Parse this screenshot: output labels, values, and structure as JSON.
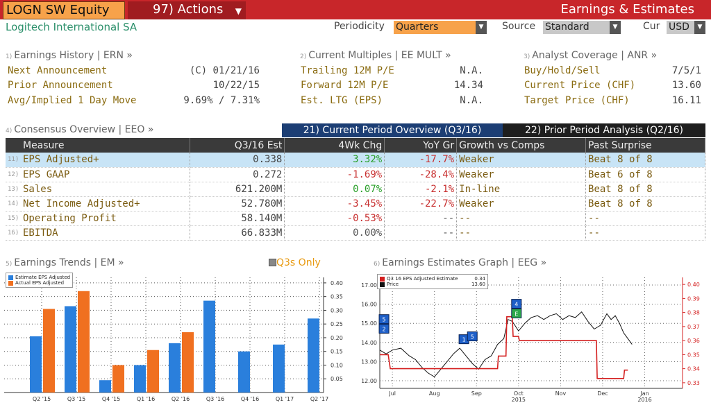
{
  "header": {
    "ticker": "LOGN SW Equity",
    "actions_label": "97) Actions",
    "title": "Earnings & Estimates",
    "company": "Logitech International SA"
  },
  "controls": {
    "periodicity_label": "Periodicity",
    "periodicity_value": "Quarters",
    "source_label": "Source",
    "source_value": "Standard",
    "cur_label": "Cur",
    "cur_value": "USD"
  },
  "earnings_history": {
    "num": "1)",
    "title": "Earnings History | ERN »",
    "rows": [
      {
        "label": "Next Announcement",
        "value": "(C)  01/21/16"
      },
      {
        "label": "Prior Announcement",
        "value": "10/22/15"
      },
      {
        "label": "Avg/Implied 1 Day Move",
        "value": "9.69% / 7.31%"
      }
    ]
  },
  "current_multiples": {
    "num": "2)",
    "title": "Current Multiples | EE MULT »",
    "rows": [
      {
        "label": "Trailing 12M P/E",
        "value": "N.A."
      },
      {
        "label": "Forward 12M P/E",
        "value": "14.34"
      },
      {
        "label": "Est. LTG (EPS)",
        "value": "N.A."
      }
    ]
  },
  "analyst_coverage": {
    "num": "3)",
    "title": "Analyst Coverage | ANR »",
    "rows": [
      {
        "label": "Buy/Hold/Sell",
        "value": "7/5/1"
      },
      {
        "label": "Current Price (CHF)",
        "value": "13.60"
      },
      {
        "label": "Target Price (CHF)",
        "value": "16.11"
      }
    ]
  },
  "consensus": {
    "num": "4)",
    "title": "Consensus Overview | EEO »",
    "tab_current": "21) Current Period Overview (Q3/16)",
    "tab_prior": "22) Prior Period Analysis (Q2/16)",
    "columns": [
      "Measure",
      "Q3/16 Est",
      "4Wk Chg",
      "YoY Gr",
      "Growth vs Comps",
      "Past Surprise"
    ],
    "rows": [
      {
        "n": "11)",
        "measure": "EPS Adjusted+",
        "est": "0.338",
        "chg": "3.32%",
        "chg_sign": "pos",
        "yoy": "-17.7%",
        "yoy_sign": "neg",
        "growth": "Weaker",
        "surprise": "Beat 8 of 8"
      },
      {
        "n": "12)",
        "measure": "EPS GAAP",
        "est": "0.272",
        "chg": "-1.69%",
        "chg_sign": "neg",
        "yoy": "-28.4%",
        "yoy_sign": "neg",
        "growth": "Weaker",
        "surprise": "Beat 6 of 8"
      },
      {
        "n": "13)",
        "measure": "Sales",
        "est": "621.200M",
        "chg": "0.07%",
        "chg_sign": "pos",
        "yoy": "-2.1%",
        "yoy_sign": "neg",
        "growth": "In-line",
        "surprise": "Beat 8 of 8"
      },
      {
        "n": "14)",
        "measure": "Net Income Adjusted+",
        "est": "52.780M",
        "chg": "-3.45%",
        "chg_sign": "neg",
        "yoy": "-22.7%",
        "yoy_sign": "neg",
        "growth": "Weaker",
        "surprise": "Beat 8 of 8"
      },
      {
        "n": "15)",
        "measure": "Operating Profit",
        "est": "58.140M",
        "chg": "-0.53%",
        "chg_sign": "neg",
        "yoy": "--",
        "yoy_sign": "nz",
        "growth": "--",
        "surprise": "--"
      },
      {
        "n": "16)",
        "measure": "EBITDA",
        "est": "66.833M",
        "chg": "0.00%",
        "chg_sign": "nz",
        "yoy": "--",
        "yoy_sign": "nz",
        "growth": "--",
        "surprise": "--"
      }
    ]
  },
  "earnings_trends": {
    "num": "5)",
    "title": "Earnings Trends | EM »",
    "toggle_label": "Q3s Only",
    "colors": {
      "estimate": "#2a7fdc",
      "actual": "#f07020"
    }
  },
  "earnings_graph": {
    "num": "6)",
    "title": "Earnings Estimates Graph | EEG »",
    "legend_estimate_label": "Q3 16 EPS Adjusted Estimate",
    "legend_estimate_value": "0.34",
    "legend_price_label": "Price",
    "legend_price_value": "13.60",
    "colors": {
      "estimate": "#d42020",
      "price": "#111111"
    }
  },
  "chart_data": [
    {
      "type": "bar",
      "categories": [
        "Q2 '15",
        "Q3 '15",
        "Q4 '15",
        "Q1 '16",
        "Q2 '16",
        "Q3 '16",
        "Q4 '16",
        "Q1 '17",
        "Q2 '17"
      ],
      "series": [
        {
          "name": "Estimate EPS Adjusted",
          "values": [
            0.205,
            0.315,
            0.045,
            0.1,
            0.18,
            0.335,
            0.15,
            0.175,
            0.27
          ]
        },
        {
          "name": "Actual EPS Adjusted",
          "values": [
            0.305,
            0.37,
            0.1,
            0.155,
            0.22,
            null,
            null,
            null,
            null
          ]
        }
      ],
      "y_ticks": [
        "0.05",
        "0.10",
        "0.15",
        "0.20",
        "0.25",
        "0.30",
        "0.35",
        "0.40"
      ],
      "ylim": [
        0,
        0.42
      ],
      "y_axis": "right",
      "legend": "top-left",
      "grid": true
    },
    {
      "type": "line",
      "x_ticks": [
        "Jul",
        "Aug",
        "Sep",
        "Oct",
        "Nov",
        "Dec",
        "Jan"
      ],
      "x_subticks": [
        "2015",
        "2016"
      ],
      "left_ticks": [
        "12.00",
        "13.00",
        "14.00",
        "15.00",
        "16.00",
        "17.00"
      ],
      "right_ticks": [
        "0.33",
        "0.34",
        "0.35",
        "0.36",
        "0.37",
        "0.38",
        "0.39",
        "0.40"
      ],
      "left_ylim": [
        11.6,
        17.4
      ],
      "right_ylim": [
        0.326,
        0.405
      ],
      "xlim": [
        0,
        7.2
      ],
      "series": [
        {
          "name": "Q3 16 EPS Adjusted Estimate",
          "axis": "right",
          "points": [
            [
              0,
              0.35
            ],
            [
              0.2,
              0.35
            ],
            [
              0.25,
              0.34
            ],
            [
              1,
              0.34
            ],
            [
              2,
              0.34
            ],
            [
              2.8,
              0.34
            ],
            [
              2.82,
              0.349
            ],
            [
              3.0,
              0.349
            ],
            [
              3.02,
              0.377
            ],
            [
              3.15,
              0.377
            ],
            [
              3.17,
              0.363
            ],
            [
              3.3,
              0.363
            ],
            [
              3.32,
              0.36
            ],
            [
              4,
              0.36
            ],
            [
              5,
              0.36
            ],
            [
              5.15,
              0.36
            ],
            [
              5.17,
              0.333
            ],
            [
              5.8,
              0.333
            ],
            [
              5.82,
              0.339
            ],
            [
              5.9,
              0.339
            ]
          ]
        },
        {
          "name": "Price",
          "axis": "left",
          "points": [
            [
              0,
              13.6
            ],
            [
              0.15,
              13.4
            ],
            [
              0.3,
              13.6
            ],
            [
              0.5,
              13.7
            ],
            [
              0.7,
              13.3
            ],
            [
              0.85,
              13.1
            ],
            [
              1.0,
              12.7
            ],
            [
              1.15,
              12.4
            ],
            [
              1.3,
              12.2
            ],
            [
              1.45,
              12.6
            ],
            [
              1.6,
              13.0
            ],
            [
              1.75,
              13.4
            ],
            [
              1.9,
              13.7
            ],
            [
              2.05,
              13.3
            ],
            [
              2.2,
              12.9
            ],
            [
              2.35,
              12.6
            ],
            [
              2.5,
              13.1
            ],
            [
              2.65,
              13.3
            ],
            [
              2.8,
              13.9
            ],
            [
              2.95,
              14.2
            ],
            [
              3.05,
              15.2
            ],
            [
              3.15,
              15.1
            ],
            [
              3.3,
              14.6
            ],
            [
              3.45,
              15.0
            ],
            [
              3.6,
              15.3
            ],
            [
              3.75,
              15.4
            ],
            [
              3.9,
              15.2
            ],
            [
              4.05,
              15.4
            ],
            [
              4.2,
              15.5
            ],
            [
              4.35,
              15.2
            ],
            [
              4.5,
              15.4
            ],
            [
              4.65,
              15.3
            ],
            [
              4.8,
              15.6
            ],
            [
              4.95,
              15.1
            ],
            [
              5.1,
              14.7
            ],
            [
              5.25,
              14.9
            ],
            [
              5.4,
              15.5
            ],
            [
              5.5,
              15.2
            ],
            [
              5.6,
              15.4
            ],
            [
              5.7,
              15.0
            ],
            [
              5.8,
              14.5
            ],
            [
              5.9,
              14.2
            ],
            [
              6.0,
              13.9
            ]
          ]
        }
      ],
      "markers": [
        {
          "label": "5",
          "x": 0.1,
          "y": 15.2
        },
        {
          "label": "2",
          "x": 0.1,
          "y": 14.7
        },
        {
          "label": "1",
          "x": 2.0,
          "y": 14.15
        },
        {
          "label": "5",
          "x": 2.2,
          "y": 14.3
        },
        {
          "label": "4",
          "x": 3.25,
          "y": 16.0
        },
        {
          "label": "E",
          "x": 3.25,
          "y": 15.5
        }
      ]
    }
  ]
}
